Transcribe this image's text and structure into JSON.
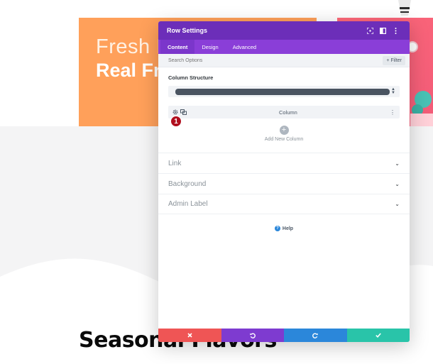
{
  "hero": {
    "line1": "Fresh I",
    "line2": "Real Fr"
  },
  "section_title": "Seasonal Flavors",
  "modal": {
    "title": "Row Settings",
    "tabs": [
      {
        "label": "Content",
        "active": true
      },
      {
        "label": "Design",
        "active": false
      },
      {
        "label": "Advanced",
        "active": false
      }
    ],
    "search": {
      "placeholder": "Search Options"
    },
    "filter_label": "+ Filter",
    "column_structure_label": "Column Structure",
    "column": {
      "label": "Column",
      "badge": "1"
    },
    "add_column_label": "Add New Column",
    "toggles": [
      {
        "label": "Link"
      },
      {
        "label": "Background"
      },
      {
        "label": "Admin Label"
      }
    ],
    "help_label": "Help",
    "footer": {
      "cancel_icon": "close-icon",
      "undo_icon": "undo-icon",
      "redo_icon": "redo-icon",
      "save_icon": "check-icon"
    }
  },
  "colors": {
    "header_purple": "#6c2eb9",
    "tab_purple": "#8a3ed8",
    "cancel_red": "#ef5555",
    "undo_purple": "#7e3bd0",
    "redo_blue": "#2b87da",
    "save_green": "#29c4a9",
    "hero_orange": "#ffa05a",
    "hero_pink": "#f25b78",
    "badge_red": "#b00f1e"
  }
}
